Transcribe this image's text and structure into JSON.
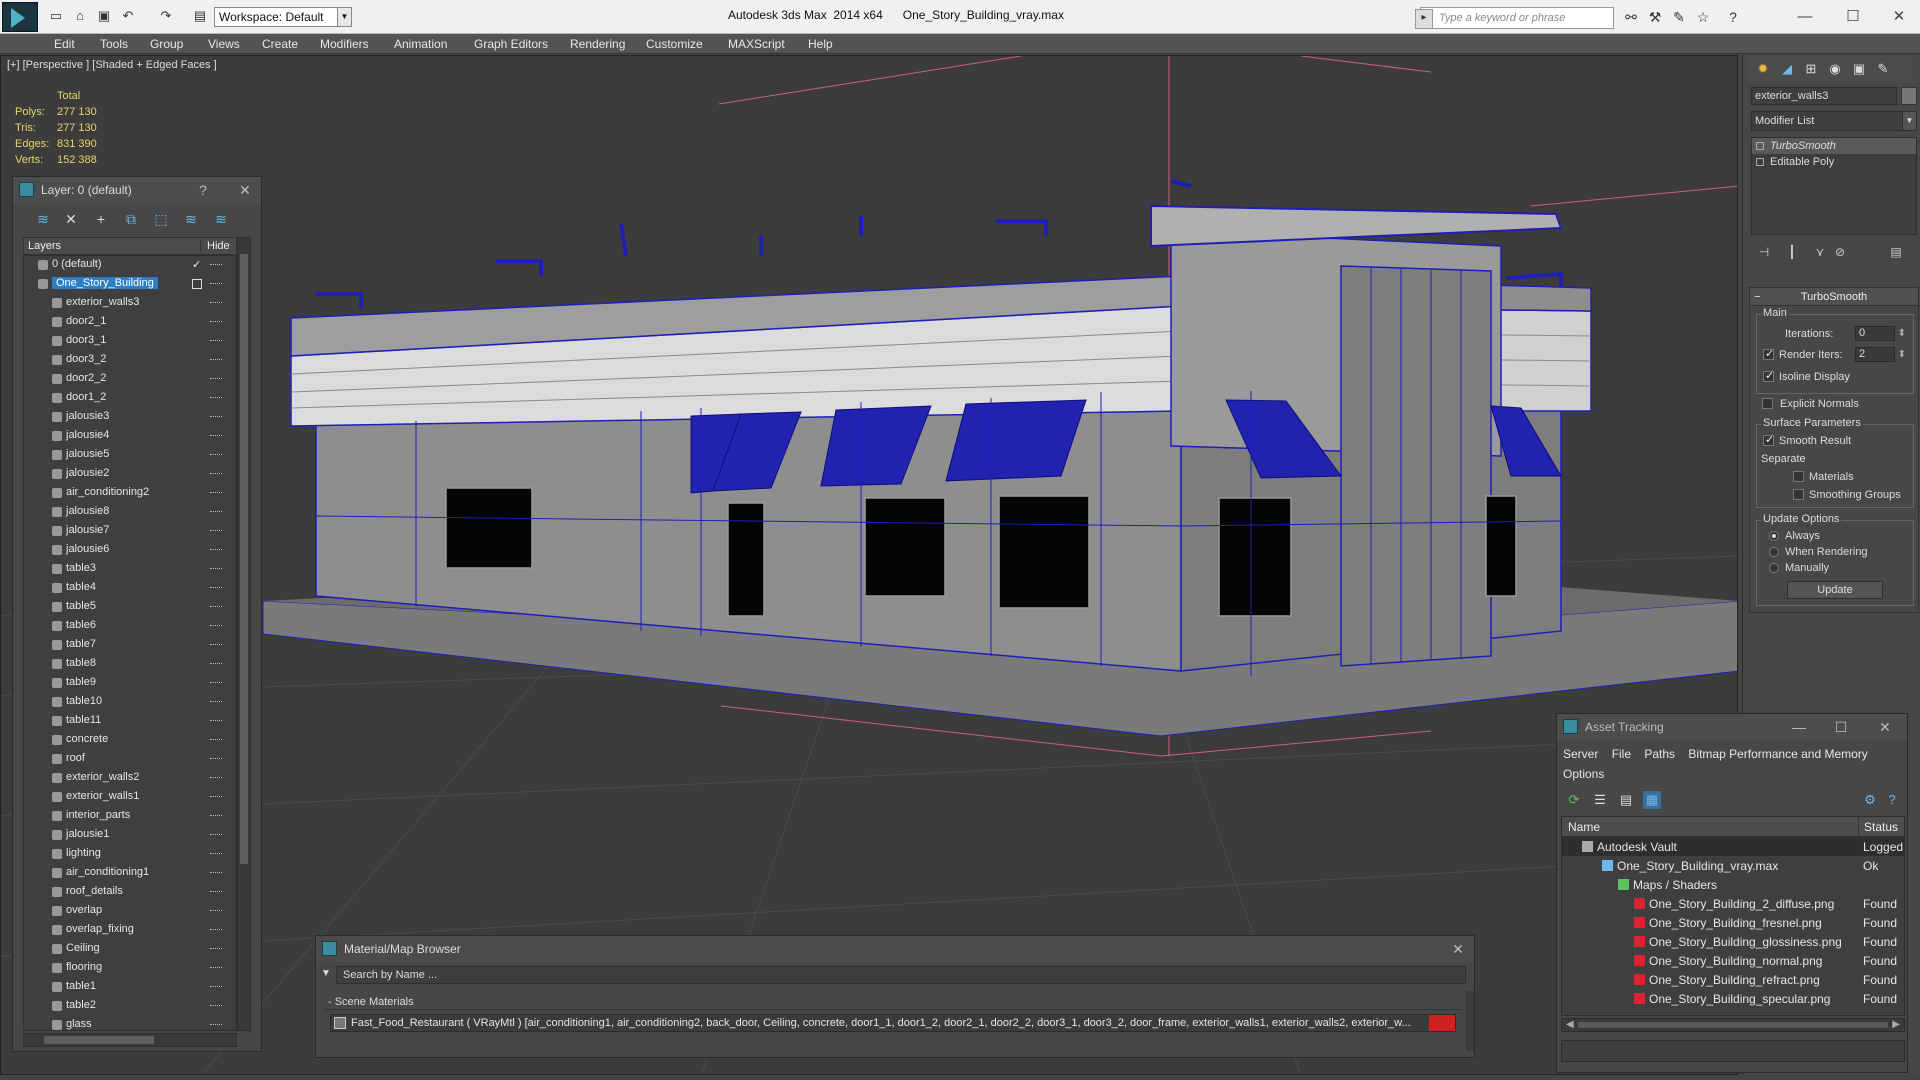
{
  "titlebar": {
    "title": "Autodesk 3ds Max  2014 x64      One_Story_Building_vray.max",
    "workspace": "Workspace: Default",
    "search_placeholder": "Type a keyword or phrase",
    "buttons": [
      "minimize",
      "maximize",
      "close"
    ]
  },
  "menu": [
    "Edit",
    "Tools",
    "Group",
    "Views",
    "Create",
    "Modifiers",
    "Animation",
    "Graph Editors",
    "Rendering",
    "Customize",
    "MAXScript",
    "Help"
  ],
  "viewport": {
    "label": "[+] [Perspective ] [Shaded + Edged Faces ]",
    "stats": {
      "header": "Total",
      "rows": [
        {
          "k": "Polys:",
          "v": "277 130"
        },
        {
          "k": "Tris:",
          "v": "277 130"
        },
        {
          "k": "Edges:",
          "v": "831 390"
        },
        {
          "k": "Verts:",
          "v": "152 388"
        }
      ]
    }
  },
  "layer_panel": {
    "title": "Layer: 0 (default)",
    "help": "?",
    "col_layers": "Layers",
    "col_hide": "Hide",
    "layers": [
      "0 (default)",
      "One_Story_Building",
      "exterior_walls3",
      "door2_1",
      "door3_1",
      "door3_2",
      "door2_2",
      "door1_2",
      "jalousie3",
      "jalousie4",
      "jalousie5",
      "jalousie2",
      "air_conditioning2",
      "jalousie8",
      "jalousie7",
      "jalousie6",
      "table3",
      "table4",
      "table5",
      "table6",
      "table7",
      "table8",
      "table9",
      "table10",
      "table11",
      "concrete",
      "roof",
      "exterior_walls2",
      "exterior_walls1",
      "interior_parts",
      "jalousie1",
      "lighting",
      "air_conditioning1",
      "roof_details",
      "overlap",
      "overlap_fixing",
      "Ceiling",
      "flooring",
      "table1",
      "table2",
      "glass"
    ]
  },
  "command_panel": {
    "object_name": "exterior_walls3",
    "modifier_list": "Modifier List",
    "stack": [
      "TurboSmooth",
      "Editable Poly"
    ],
    "rollout_title": "TurboSmooth",
    "main": "Main",
    "iterations_label": "Iterations:",
    "iterations": "0",
    "render_iters_label": "Render Iters:",
    "render_iters": "2",
    "isoline": "Isoline Display",
    "explicit": "Explicit Normals",
    "surface": "Surface Parameters",
    "smooth_result": "Smooth Result",
    "separate": "Separate",
    "materials": "Materials",
    "smoothing_groups": "Smoothing Groups",
    "update_options": "Update Options",
    "always": "Always",
    "when_rendering": "When Rendering",
    "manually": "Manually",
    "update": "Update"
  },
  "material_browser": {
    "title": "Material/Map Browser",
    "search": "Search by Name ...",
    "section": "- Scene Materials",
    "item": "Fast_Food_Restaurant ( VRayMtl ) [air_conditioning1, air_conditioning2, back_door, Ceiling, concrete, door1_1, door1_2, door2_1, door2_2, door3_1, door3_2, door_frame, exterior_walls1, exterior_walls2, exterior_w..."
  },
  "asset_tracking": {
    "title": "Asset Tracking",
    "menu": [
      "Server",
      "File",
      "Paths",
      "Bitmap Performance and Memory",
      "Options"
    ],
    "col_name": "Name",
    "col_status": "Status",
    "rows": [
      {
        "name": "Autodesk Vault",
        "status": "Logged O",
        "indent": 20,
        "icon": "vault"
      },
      {
        "name": "One_Story_Building_vray.max",
        "status": "Ok",
        "indent": 40,
        "icon": "max"
      },
      {
        "name": "Maps / Shaders",
        "status": "",
        "indent": 56,
        "icon": "maps"
      },
      {
        "name": "One_Story_Building_2_diffuse.png",
        "status": "Found",
        "indent": 72,
        "icon": "png"
      },
      {
        "name": "One_Story_Building_fresnel.png",
        "status": "Found",
        "indent": 72,
        "icon": "png"
      },
      {
        "name": "One_Story_Building_glossiness.png",
        "status": "Found",
        "indent": 72,
        "icon": "png"
      },
      {
        "name": "One_Story_Building_normal.png",
        "status": "Found",
        "indent": 72,
        "icon": "png"
      },
      {
        "name": "One_Story_Building_refract.png",
        "status": "Found",
        "indent": 72,
        "icon": "png"
      },
      {
        "name": "One_Story_Building_specular.png",
        "status": "Found",
        "indent": 72,
        "icon": "png"
      }
    ]
  },
  "colors": {
    "wire": "#1f1fb5",
    "selection": "#2a7fc7",
    "stats": "#e7d46a",
    "accent": "#3b8ea0"
  }
}
